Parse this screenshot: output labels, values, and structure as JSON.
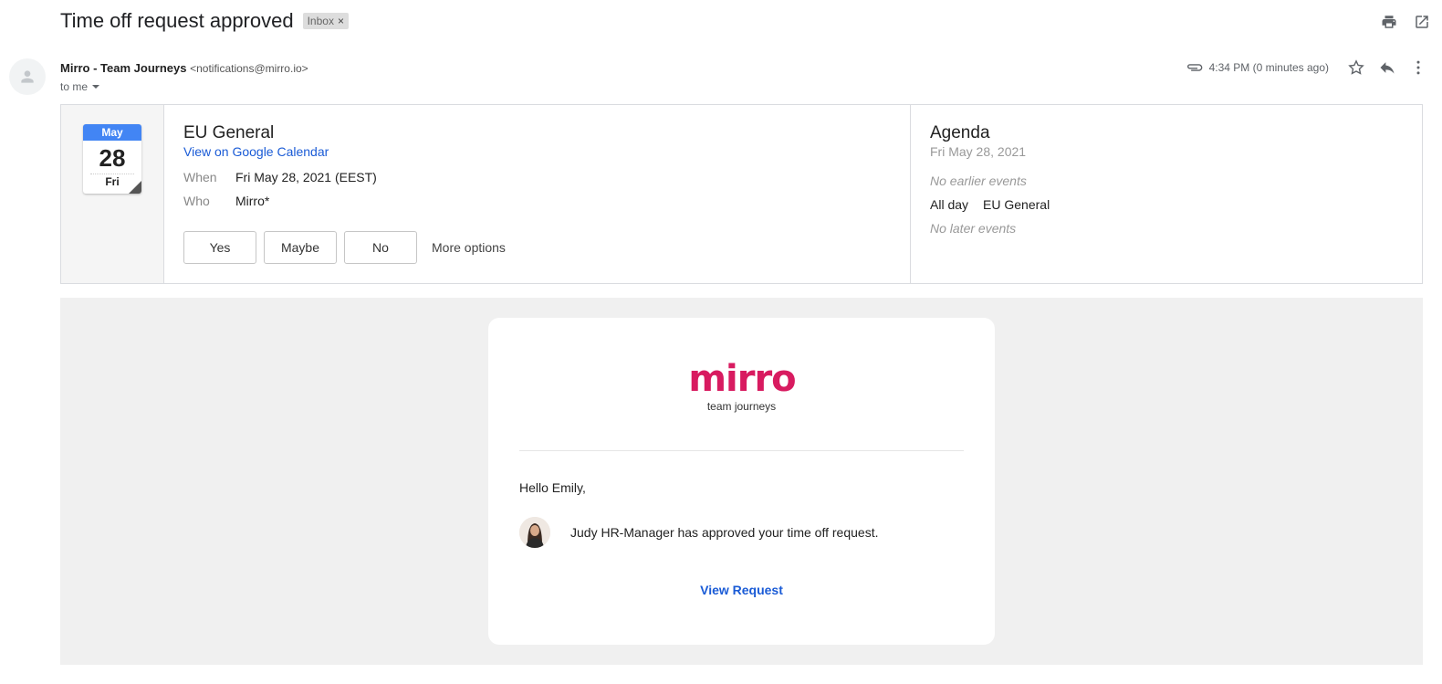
{
  "email": {
    "subject": "Time off request approved",
    "label": "Inbox",
    "label_remove": "×",
    "sender_name": "Mirro - Team Journeys",
    "sender_email": "<notifications@mirro.io>",
    "to_label": "to me",
    "time": "4:34 PM (0 minutes ago)"
  },
  "icons": {
    "print": "print-icon",
    "popout": "open-in-new-icon",
    "attachment": "paperclip-icon",
    "star": "star-icon",
    "reply": "reply-icon",
    "more": "more-vert-icon",
    "avatar": "person-icon"
  },
  "calendar": {
    "month": "May",
    "day": "28",
    "weekday": "Fri",
    "event_title": "EU General",
    "gcal_link": "View on Google Calendar",
    "when_label": "When",
    "when_value": "Fri May 28, 2021 (EEST)",
    "who_label": "Who",
    "who_value": "Mirro*",
    "rsvp": [
      "Yes",
      "Maybe",
      "No"
    ],
    "more_options": "More options",
    "accent_color": "#4285f4"
  },
  "agenda": {
    "title": "Agenda",
    "date": "Fri May 28, 2021",
    "no_earlier": "No earlier events",
    "event_time": "All day",
    "event_name": "EU General",
    "no_later": "No later events"
  },
  "message": {
    "logo_text": "mirro",
    "tagline": "team journeys",
    "greeting": "Hello Emily,",
    "approval_text": "Judy HR-Manager has approved your time off request.",
    "cta": "View Request",
    "brand_color": "#d81b60",
    "link_color": "#1a5bd6"
  }
}
